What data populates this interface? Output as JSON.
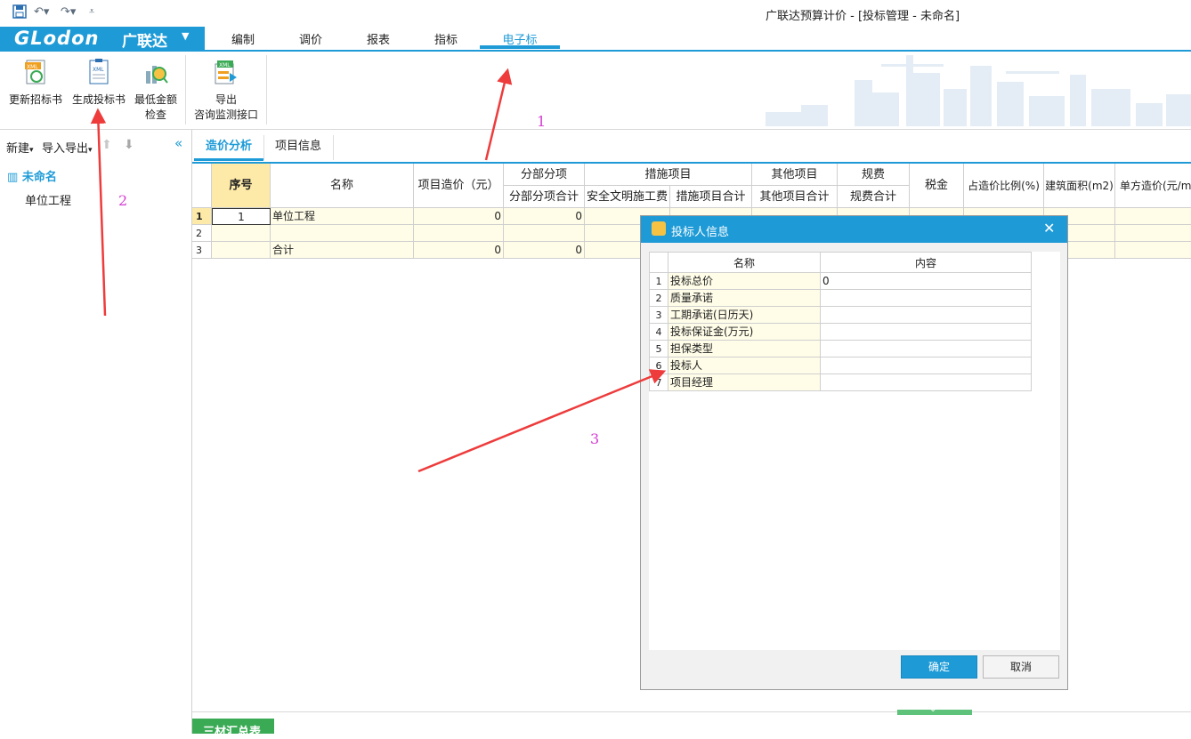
{
  "window": {
    "title": "广联达预算计价 - [投标管理 - 未命名]"
  },
  "brand": {
    "logo": "GLodon",
    "name": "广联达"
  },
  "ribbon_tabs": [
    "编制",
    "调价",
    "报表",
    "指标",
    "电子标"
  ],
  "toolbar": {
    "update_bid": "更新招标书",
    "generate_bid": "生成投标书",
    "min_check_1": "最低金额",
    "min_check_2": "检查",
    "export_1": "导出",
    "export_2": "咨询监测接口"
  },
  "left_panel": {
    "new_label": "新建",
    "import_export_label": "导入导出",
    "tree_root": "未命名",
    "tree_child": "单位工程"
  },
  "content_tabs": [
    "造价分析",
    "项目信息"
  ],
  "grid": {
    "headers": {
      "seq": "序号",
      "name": "名称",
      "project_cost": "项目造价（元）",
      "fbfx": "分部分项",
      "fbfx_total": "分部分项合计",
      "measures": "措施项目",
      "safety": "安全文明施工费",
      "measures_total": "措施项目合计",
      "other": "其他项目",
      "other_total": "其他项目合计",
      "fees": "规费",
      "fees_total": "规费合计",
      "tax": "税金",
      "ratio": "占造价比例(%)",
      "area": "建筑面积(m2)",
      "unit_cost": "单方造价(元/m"
    },
    "rows": [
      {
        "num": "1",
        "seq": "1",
        "name": "单位工程",
        "cost": "0",
        "fbfx": "0"
      },
      {
        "num": "2",
        "seq": "",
        "name": "",
        "cost": "",
        "fbfx": ""
      },
      {
        "num": "3",
        "seq": "",
        "name": "合计",
        "cost": "0",
        "fbfx": "0"
      }
    ]
  },
  "bottom_tab": "三材汇总表",
  "dialog": {
    "title": "投标人信息",
    "col_name": "名称",
    "col_content": "内容",
    "rows": [
      {
        "num": "1",
        "name": "投标总价",
        "content": "0"
      },
      {
        "num": "2",
        "name": "质量承诺",
        "content": ""
      },
      {
        "num": "3",
        "name": "工期承诺(日历天)",
        "content": ""
      },
      {
        "num": "4",
        "name": "投标保证金(万元)",
        "content": ""
      },
      {
        "num": "5",
        "name": "担保类型",
        "content": ""
      },
      {
        "num": "6",
        "name": "投标人",
        "content": ""
      },
      {
        "num": "7",
        "name": "项目经理",
        "content": ""
      }
    ],
    "ok": "确定",
    "cancel": "取消"
  },
  "annotations": [
    "1",
    "2",
    "3"
  ],
  "colors": {
    "accent": "#1e9bd7",
    "arrow": "#ee3b3b",
    "annotation": "#d43ed3"
  }
}
